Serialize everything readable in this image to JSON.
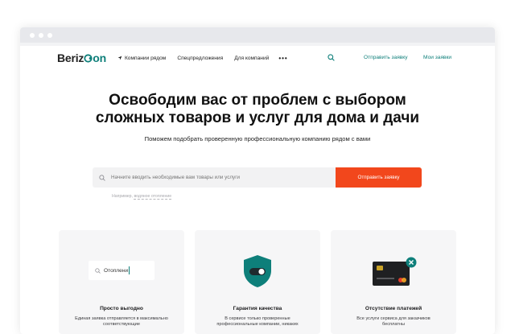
{
  "browser": {
    "dots": 3
  },
  "header": {
    "logo_text": "Beriz",
    "logo_on": "on",
    "nav": [
      {
        "label": "Компании рядом"
      },
      {
        "label": "Спецпредложения"
      },
      {
        "label": "Для компаний"
      }
    ],
    "more": "•••",
    "send_link": "Отправить заявку",
    "my_link": "Мои заявки"
  },
  "hero": {
    "title_line1": "Освободим вас от проблем с выбором",
    "title_line2": "сложных товаров и услуг для дома и дачи",
    "subtitle": "Поможем подобрать проверенную профессиональную компанию рядом с вами"
  },
  "search": {
    "placeholder": "Начните вводить необходимые вам товары или услуги",
    "button": "Отправить заявку",
    "hint_prefix": "Например,",
    "hint_example": "водяное отопление"
  },
  "cards": [
    {
      "title": "Просто выгодно",
      "text": "Единая заявка отправляется в максимально соответствующие",
      "demo_query": "Отоплени"
    },
    {
      "title": "Гарантия качества",
      "text": "В сервисе только проверенные профессиональные компании, никаких"
    },
    {
      "title": "Отсутствие платежей",
      "text": "Все услуги сервиса для заказчиков бесплатны"
    }
  ],
  "colors": {
    "accent": "#0e7f7a",
    "button": "#f2471c"
  }
}
